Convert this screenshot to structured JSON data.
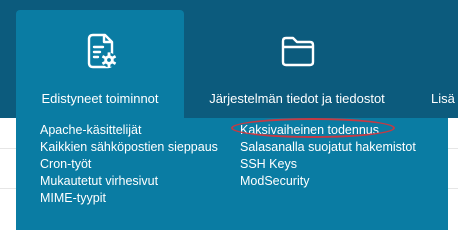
{
  "nav": {
    "tabs": [
      {
        "label": "Edistyneet toiminnot",
        "icon": "document-gear-icon",
        "active": true
      },
      {
        "label": "Järjestelmän tiedot ja tiedostot",
        "icon": "folder-icon",
        "active": false
      },
      {
        "label": "Lisä",
        "icon": "",
        "active": false
      }
    ]
  },
  "dropdown": {
    "columns": [
      [
        "Apache-käsittelijät",
        "Kaikkien sähköpostien sieppaus",
        "Cron-työt",
        "Mukautetut virhesivut",
        "MIME-tyypit"
      ],
      [
        "Kaksivaiheinen todennus",
        "Salasanalla suojatut hakemistot",
        "SSH Keys",
        "ModSecurity"
      ]
    ],
    "highlighted": "Kaksivaiheinen todennus"
  },
  "colors": {
    "header_bg": "#0c5b7d",
    "active_tab_bg": "#0a7ca3",
    "highlight_ring": "#c33a44",
    "text": "#ffffff"
  }
}
